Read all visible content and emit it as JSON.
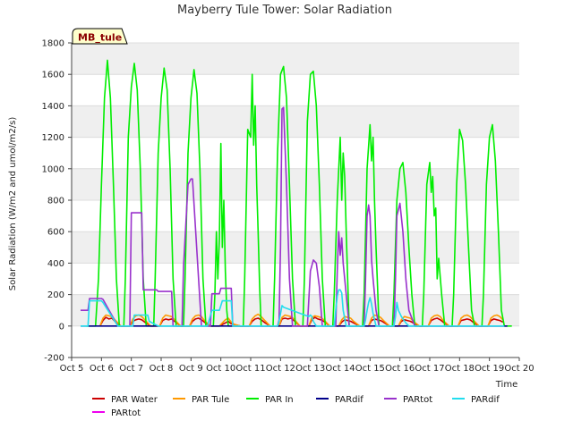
{
  "chart_data": {
    "type": "line",
    "title": "Mayberry Tule Tower: Solar Radiation",
    "xlabel": "Time",
    "ylabel": "Solar Radiation (W/m2 and umol/m2/s)",
    "badge": "MB_tule",
    "xlim": [
      5,
      20
    ],
    "ylim": [
      -200,
      1800
    ],
    "x_ticks": [
      5,
      6,
      7,
      8,
      9,
      10,
      11,
      12,
      13,
      14,
      15,
      16,
      17,
      18,
      19,
      20
    ],
    "x_tick_labels": [
      "Oct 5",
      "Oct 6",
      "Oct 7",
      "Oct 8",
      "Oct 9",
      "Oct 10",
      "Oct 11",
      "Oct 12",
      "Oct 13",
      "Oct 14",
      "Oct 15",
      "Oct 16",
      "Oct 17",
      "Oct 18",
      "Oct 19",
      "Oct 20"
    ],
    "y_ticks": [
      -200,
      0,
      200,
      400,
      600,
      800,
      1000,
      1200,
      1400,
      1600,
      1800
    ],
    "y_tick_labels": [
      "-200",
      "0",
      "200",
      "400",
      "600",
      "800",
      "1000",
      "1200",
      "1400",
      "1600",
      "1800"
    ],
    "grid": true,
    "legend_position": "bottom",
    "series": [
      {
        "name": "PAR Water",
        "color": "#cc0000",
        "x": [
          5.95,
          6.05,
          6.15,
          6.25,
          6.35,
          6.45,
          6.65,
          6.95,
          7.05,
          7.15,
          7.25,
          7.35,
          7.45,
          7.65,
          7.95,
          8.05,
          8.15,
          8.25,
          8.35,
          8.45,
          8.65,
          8.95,
          9.05,
          9.15,
          9.25,
          9.35,
          9.45,
          9.65,
          9.95,
          10.05,
          10.15,
          10.25,
          10.35,
          10.45,
          10.65,
          10.95,
          11.05,
          11.15,
          11.25,
          11.35,
          11.45,
          11.65,
          11.95,
          12.05,
          12.15,
          12.25,
          12.35,
          12.45,
          12.65,
          12.95,
          13.05,
          13.15,
          13.25,
          13.35,
          13.45,
          13.65,
          13.95,
          14.05,
          14.15,
          14.25,
          14.35,
          14.45,
          14.65,
          14.95,
          15.05,
          15.15,
          15.25,
          15.35,
          15.45,
          15.65,
          15.95,
          16.05,
          16.15,
          16.25,
          16.35,
          16.45,
          16.65,
          16.95,
          17.05,
          17.15,
          17.25,
          17.35,
          17.45,
          17.65,
          17.95,
          18.05,
          18.15,
          18.25,
          18.35,
          18.45,
          18.65,
          18.95,
          19.05,
          19.15,
          19.25,
          19.35,
          19.45
        ],
        "y": [
          0,
          35,
          55,
          45,
          50,
          30,
          0,
          0,
          30,
          40,
          45,
          40,
          25,
          0,
          0,
          35,
          45,
          40,
          45,
          30,
          0,
          0,
          30,
          45,
          50,
          40,
          25,
          0,
          0,
          10,
          20,
          30,
          15,
          10,
          0,
          0,
          30,
          45,
          50,
          40,
          25,
          0,
          0,
          45,
          50,
          45,
          50,
          35,
          0,
          0,
          40,
          55,
          45,
          40,
          30,
          0,
          0,
          25,
          40,
          35,
          30,
          20,
          0,
          0,
          35,
          45,
          40,
          35,
          25,
          0,
          0,
          30,
          40,
          35,
          30,
          20,
          0,
          0,
          35,
          45,
          50,
          40,
          25,
          0,
          0,
          35,
          40,
          45,
          40,
          25,
          0,
          0,
          35,
          45,
          40,
          35,
          25
        ]
      },
      {
        "name": "PAR Tule",
        "color": "#ff9900",
        "x": [
          5.95,
          6.05,
          6.15,
          6.25,
          6.35,
          6.45,
          6.65,
          6.95,
          7.05,
          7.15,
          7.25,
          7.35,
          7.45,
          7.65,
          7.95,
          8.05,
          8.15,
          8.25,
          8.35,
          8.45,
          8.65,
          8.95,
          9.05,
          9.15,
          9.25,
          9.35,
          9.45,
          9.65,
          9.95,
          10.05,
          10.15,
          10.25,
          10.35,
          10.45,
          10.65,
          10.95,
          11.05,
          11.15,
          11.25,
          11.35,
          11.45,
          11.65,
          11.95,
          12.05,
          12.15,
          12.25,
          12.35,
          12.45,
          12.65,
          12.95,
          13.05,
          13.15,
          13.25,
          13.35,
          13.45,
          13.65,
          13.95,
          14.05,
          14.15,
          14.25,
          14.35,
          14.45,
          14.65,
          14.95,
          15.05,
          15.15,
          15.25,
          15.35,
          15.45,
          15.65,
          15.95,
          16.05,
          16.15,
          16.25,
          16.35,
          16.45,
          16.65,
          16.95,
          17.05,
          17.15,
          17.25,
          17.35,
          17.45,
          17.65,
          17.95,
          18.05,
          18.15,
          18.25,
          18.35,
          18.45,
          18.65,
          18.95,
          19.05,
          19.15,
          19.25,
          19.35,
          19.45
        ],
        "y": [
          0,
          50,
          70,
          65,
          60,
          40,
          0,
          0,
          45,
          65,
          70,
          60,
          40,
          0,
          0,
          50,
          70,
          65,
          60,
          40,
          0,
          0,
          45,
          65,
          70,
          60,
          35,
          0,
          0,
          20,
          40,
          50,
          25,
          10,
          0,
          0,
          45,
          65,
          75,
          60,
          40,
          0,
          0,
          55,
          70,
          65,
          60,
          45,
          0,
          0,
          55,
          65,
          60,
          55,
          40,
          0,
          0,
          40,
          60,
          55,
          50,
          30,
          0,
          0,
          50,
          70,
          65,
          55,
          35,
          0,
          0,
          40,
          60,
          55,
          50,
          30,
          0,
          0,
          50,
          65,
          70,
          60,
          35,
          0,
          0,
          50,
          65,
          70,
          60,
          40,
          0,
          0,
          50,
          65,
          70,
          60,
          40
        ]
      },
      {
        "name": "PAR In",
        "color": "#00ee00",
        "x": [
          5.5,
          5.8,
          5.9,
          6.0,
          6.1,
          6.2,
          6.3,
          6.4,
          6.5,
          6.6,
          6.75,
          6.8,
          6.9,
          7.0,
          7.1,
          7.2,
          7.3,
          7.4,
          7.5,
          7.6,
          7.75,
          7.8,
          7.9,
          8.0,
          8.1,
          8.2,
          8.3,
          8.4,
          8.5,
          8.6,
          8.75,
          8.8,
          8.9,
          9.0,
          9.1,
          9.2,
          9.3,
          9.4,
          9.5,
          9.6,
          9.75,
          9.8,
          9.85,
          9.9,
          9.95,
          10.0,
          10.05,
          10.1,
          10.15,
          10.2,
          10.25,
          10.3,
          10.35,
          10.4,
          10.5,
          10.6,
          10.75,
          10.8,
          10.9,
          11.0,
          11.05,
          11.1,
          11.15,
          11.2,
          11.25,
          11.3,
          11.35,
          11.4,
          11.5,
          11.6,
          11.75,
          11.8,
          11.9,
          12.0,
          12.1,
          12.2,
          12.3,
          12.4,
          12.5,
          12.6,
          12.75,
          12.8,
          12.9,
          13.0,
          13.1,
          13.2,
          13.3,
          13.4,
          13.5,
          13.6,
          13.75,
          13.8,
          13.9,
          14.0,
          14.05,
          14.1,
          14.15,
          14.2,
          14.25,
          14.3,
          14.4,
          14.5,
          14.6,
          14.75,
          14.8,
          14.9,
          15.0,
          15.05,
          15.1,
          15.15,
          15.2,
          15.25,
          15.3,
          15.4,
          15.5,
          15.6,
          15.75,
          15.8,
          15.9,
          16.0,
          16.1,
          16.2,
          16.3,
          16.4,
          16.5,
          16.6,
          16.75,
          16.8,
          16.9,
          17.0,
          17.05,
          17.1,
          17.15,
          17.2,
          17.25,
          17.3,
          17.4,
          17.5,
          17.6,
          17.75,
          17.8,
          17.9,
          18.0,
          18.1,
          18.2,
          18.3,
          18.4,
          18.5,
          18.6,
          18.75,
          18.8,
          18.9,
          19.0,
          19.1,
          19.2,
          19.3,
          19.4,
          19.5,
          19.6,
          19.75
        ],
        "y": [
          0,
          0,
          300,
          900,
          1450,
          1690,
          1450,
          900,
          300,
          0,
          0,
          300,
          1200,
          1520,
          1670,
          1500,
          1000,
          300,
          0,
          0,
          0,
          300,
          1100,
          1450,
          1640,
          1500,
          1000,
          300,
          0,
          0,
          0,
          300,
          1100,
          1450,
          1630,
          1480,
          1000,
          300,
          0,
          0,
          0,
          200,
          600,
          300,
          550,
          1160,
          500,
          800,
          350,
          100,
          0,
          0,
          0,
          0,
          0,
          0,
          0,
          300,
          1250,
          1200,
          1600,
          1150,
          1400,
          900,
          600,
          250,
          0,
          0,
          0,
          0,
          0,
          300,
          1100,
          1600,
          1650,
          1450,
          900,
          300,
          0,
          0,
          0,
          300,
          1300,
          1600,
          1620,
          1400,
          900,
          300,
          0,
          0,
          0,
          200,
          800,
          1200,
          800,
          1100,
          950,
          600,
          300,
          0,
          0,
          0,
          0,
          0,
          200,
          1000,
          1280,
          1050,
          1200,
          800,
          500,
          250,
          0,
          0,
          0,
          0,
          0,
          200,
          800,
          1000,
          1040,
          850,
          500,
          200,
          0,
          0,
          0,
          200,
          900,
          1040,
          850,
          950,
          700,
          750,
          300,
          430,
          200,
          0,
          0,
          0,
          200,
          900,
          1250,
          1180,
          900,
          500,
          100,
          0,
          0,
          0,
          200,
          900,
          1200,
          1280,
          1050,
          600,
          100,
          0,
          0,
          0
        ]
      },
      {
        "name": "PARdif",
        "color": "#00008b",
        "x": [
          5.3,
          5.5,
          5.9,
          6.6,
          6.8,
          7.6,
          7.8,
          8.6,
          8.8,
          9.6,
          9.8,
          10.6,
          10.8,
          11.6,
          11.8,
          12.6,
          12.8,
          13.6,
          13.8,
          14.6,
          14.8,
          15.6,
          15.8,
          16.6,
          16.8,
          17.6,
          17.8,
          18.6,
          18.8,
          19.6
        ],
        "y": [
          0,
          0,
          0,
          0,
          0,
          0,
          0,
          0,
          0,
          0,
          0,
          0,
          0,
          0,
          0,
          0,
          0,
          0,
          0,
          0,
          0,
          0,
          0,
          0,
          0,
          0,
          0,
          0,
          0,
          0
        ]
      },
      {
        "name": "PARtot",
        "color": "#9932cc",
        "x": [
          5.3,
          5.55,
          5.6,
          6.0,
          6.05,
          6.55,
          6.65,
          6.95,
          7.0,
          7.35,
          7.4,
          7.85,
          7.9,
          8.35,
          8.4,
          8.7,
          8.75,
          8.9,
          9.0,
          9.05,
          9.35,
          9.45,
          9.65,
          9.7,
          9.95,
          10.0,
          10.35,
          10.4,
          10.9,
          11.0,
          11.05,
          11.55,
          11.6,
          11.85,
          11.9,
          11.95,
          12.0,
          12.05,
          12.1,
          12.2,
          12.3,
          12.4,
          12.5,
          12.8,
          12.9,
          13.0,
          13.1,
          13.2,
          13.3,
          13.4,
          13.5,
          13.75,
          13.8,
          13.85,
          13.9,
          13.95,
          14.0,
          14.05,
          14.1,
          14.2,
          14.3,
          14.75,
          14.8,
          14.85,
          14.9,
          14.95,
          15.0,
          15.05,
          15.1,
          15.2,
          15.3,
          15.75,
          15.8,
          15.85,
          15.9,
          16.0,
          16.1,
          16.2,
          16.3,
          16.5,
          19.5
        ],
        "y": [
          100,
          100,
          175,
          175,
          170,
          0,
          0,
          0,
          720,
          720,
          230,
          230,
          220,
          220,
          0,
          0,
          380,
          900,
          935,
          935,
          0,
          0,
          0,
          205,
          205,
          240,
          240,
          0,
          0,
          0,
          0,
          0,
          0,
          0,
          0,
          40,
          500,
          1380,
          1390,
          900,
          300,
          0,
          0,
          0,
          0,
          350,
          420,
          400,
          250,
          0,
          0,
          0,
          0,
          0,
          350,
          600,
          450,
          560,
          400,
          200,
          0,
          0,
          0,
          300,
          700,
          770,
          700,
          420,
          300,
          100,
          0,
          0,
          0,
          300,
          700,
          780,
          600,
          300,
          100,
          0,
          0
        ]
      },
      {
        "name": "PARdif",
        "color": "#22ddee",
        "x": [
          5.3,
          5.55,
          5.6,
          6.0,
          6.05,
          6.55,
          6.65,
          6.95,
          7.05,
          7.1,
          7.55,
          7.6,
          7.9,
          9.55,
          9.7,
          9.95,
          10.0,
          10.05,
          10.35,
          10.4,
          11.9,
          11.95,
          12.05,
          12.1,
          12.95,
          13.0,
          13.05,
          13.1,
          13.2,
          13.75,
          13.8,
          13.85,
          13.9,
          13.95,
          14.0,
          14.05,
          14.1,
          14.2,
          14.75,
          14.8,
          14.85,
          14.9,
          14.95,
          15.0,
          15.05,
          15.1,
          15.2,
          15.75,
          15.8,
          15.85,
          15.9,
          15.95,
          16.05,
          16.2,
          16.3,
          19.5
        ],
        "y": [
          0,
          0,
          160,
          160,
          150,
          0,
          0,
          0,
          0,
          70,
          70,
          30,
          0,
          0,
          100,
          100,
          130,
          160,
          160,
          0,
          0,
          30,
          130,
          120,
          60,
          70,
          60,
          30,
          0,
          0,
          0,
          100,
          190,
          230,
          230,
          210,
          100,
          0,
          0,
          0,
          40,
          100,
          150,
          180,
          140,
          80,
          0,
          0,
          0,
          60,
          150,
          100,
          60,
          20,
          0,
          0
        ]
      }
    ],
    "legend": [
      {
        "name": "PAR Water",
        "color": "#cc0000"
      },
      {
        "name": "PAR Tule",
        "color": "#ff9900"
      },
      {
        "name": "PAR In",
        "color": "#00ee00"
      },
      {
        "name": "PARdif",
        "color": "#00008b"
      },
      {
        "name": "PARtot",
        "color": "#9932cc"
      },
      {
        "name": "PARdif",
        "color": "#22ddee"
      },
      {
        "name": "PARtot",
        "color": "#ee00ee"
      }
    ],
    "extra_series_color": "#ee00ee"
  }
}
